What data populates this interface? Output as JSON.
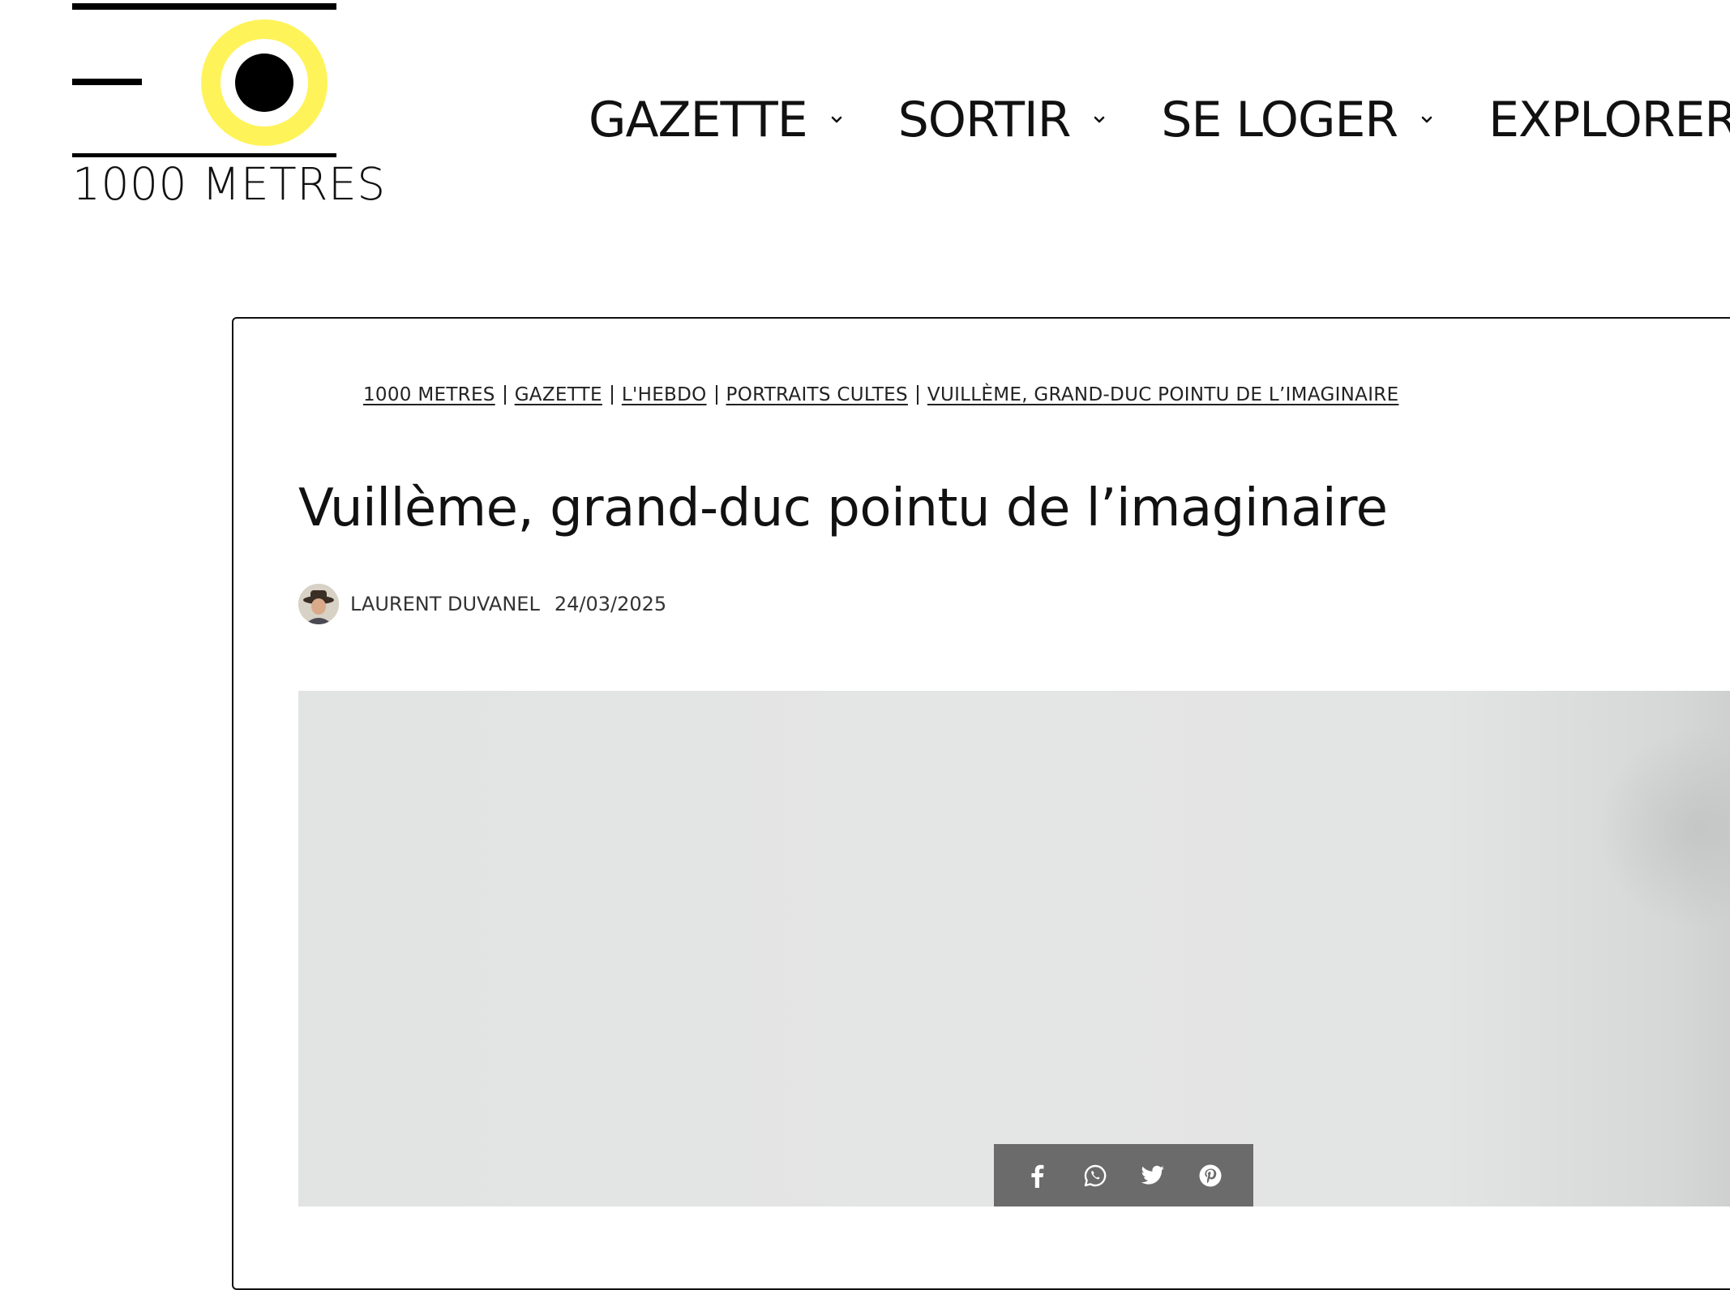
{
  "logo": {
    "text": "1000 METRES",
    "colors": {
      "ring": "#fff35a",
      "dot": "#000000",
      "bars": "#000000"
    }
  },
  "nav": {
    "items": [
      {
        "label": "GAZETTE",
        "icon": "chevron-down-icon"
      },
      {
        "label": "SORTIR",
        "icon": "chevron-down-icon"
      },
      {
        "label": "SE LOGER",
        "icon": "chevron-down-icon"
      },
      {
        "label": "EXPLORER",
        "icon": "chevron-down-icon"
      }
    ]
  },
  "breadcrumb": {
    "items": [
      "1000 METRES",
      "GAZETTE",
      "L'HEBDO",
      "PORTRAITS CULTES",
      "VUILLÈME, GRAND-DUC POINTU DE L’IMAGINAIRE"
    ]
  },
  "article": {
    "title": "Vuillème, grand-duc pointu de l’imaginaire",
    "author": "LAURENT DUVANEL",
    "date": "24/03/2025"
  },
  "share": {
    "buttons": [
      "facebook-icon",
      "whatsapp-icon",
      "twitter-icon",
      "pinterest-icon"
    ],
    "background": "#6b6b6b"
  }
}
